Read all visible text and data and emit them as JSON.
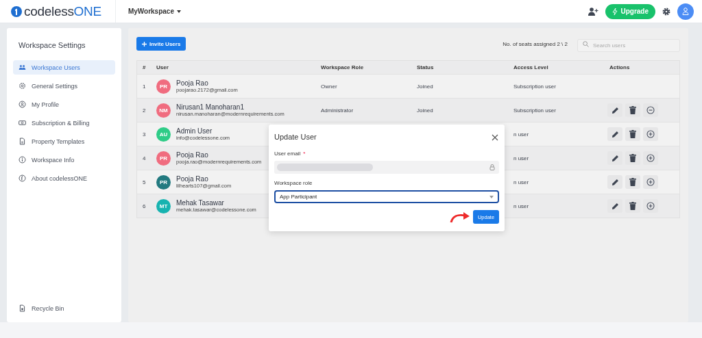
{
  "topbar": {
    "logo": {
      "text": "codeless",
      "accent": "ONE"
    },
    "workspace": "MyWorkspace",
    "upgrade": "Upgrade"
  },
  "sidebar": {
    "title": "Workspace Settings",
    "items": [
      {
        "label": "Workspace Users",
        "selected": true
      },
      {
        "label": "General Settings",
        "selected": false
      },
      {
        "label": "My Profile",
        "selected": false
      },
      {
        "label": "Subscription & Billing",
        "selected": false
      },
      {
        "label": "Property Templates",
        "selected": false
      },
      {
        "label": "Workspace Info",
        "selected": false
      },
      {
        "label": "About codelessONE",
        "selected": false
      }
    ],
    "footer": {
      "label": "Recycle Bin"
    }
  },
  "toolbar": {
    "invite": "Invite Users",
    "seats": "No. of seats assigned 2 \\ 2",
    "search": {
      "placeholder": "Search users"
    }
  },
  "table": {
    "columns": [
      "#",
      "User",
      "Workspace Role",
      "Status",
      "Access Level",
      "Actions"
    ],
    "rows": [
      {
        "index": "1",
        "initials": "PR",
        "color": "#f06c7f",
        "name": "Pooja Rao",
        "email": "poojarao.2172@gmail.com",
        "role": "Owner",
        "status": "Joined",
        "access": "Subscription user",
        "actions": []
      },
      {
        "index": "2",
        "initials": "NM",
        "color": "#f06c7f",
        "name": "Nirusan1 Manoharan1",
        "email": "nirusan.manoharan@modernrequirements.com",
        "role": "Administrator",
        "status": "Joined",
        "access": "Subscription user",
        "actions": [
          {
            "kind": "edit"
          },
          {
            "kind": "delete"
          },
          {
            "kind": "remove"
          }
        ]
      },
      {
        "index": "3",
        "initials": "AU",
        "color": "#2ecc87",
        "name": "Admin User",
        "email": "info@codelessone.com",
        "access": "n user",
        "actions": [
          {
            "kind": "edit"
          },
          {
            "kind": "delete"
          },
          {
            "kind": "add"
          }
        ]
      },
      {
        "index": "4",
        "initials": "PR",
        "color": "#f06c7f",
        "name": "Pooja Rao",
        "email": "pooja.rao@modernrequirements.com",
        "access": "n user",
        "actions": [
          {
            "kind": "edit"
          },
          {
            "kind": "delete"
          },
          {
            "kind": "add"
          }
        ]
      },
      {
        "index": "5",
        "initials": "PR",
        "color": "#237a80",
        "name": "Pooja Rao",
        "email": "lilhearts107@gmail.com",
        "access": "n user",
        "actions": [
          {
            "kind": "edit"
          },
          {
            "kind": "delete"
          },
          {
            "kind": "add"
          }
        ]
      },
      {
        "index": "6",
        "initials": "MT",
        "color": "#17b3b0",
        "name": "Mehak Tasawar",
        "email": "mehak.tasawar@codelessone.com",
        "access": "n user",
        "actions": [
          {
            "kind": "edit"
          },
          {
            "kind": "delete"
          },
          {
            "kind": "add"
          }
        ]
      }
    ]
  },
  "dialog": {
    "title": "Update User",
    "email_label": "User email",
    "required_mark": "*",
    "role_label": "Workspace role",
    "role_value": "App Participant",
    "submit": "Update"
  }
}
